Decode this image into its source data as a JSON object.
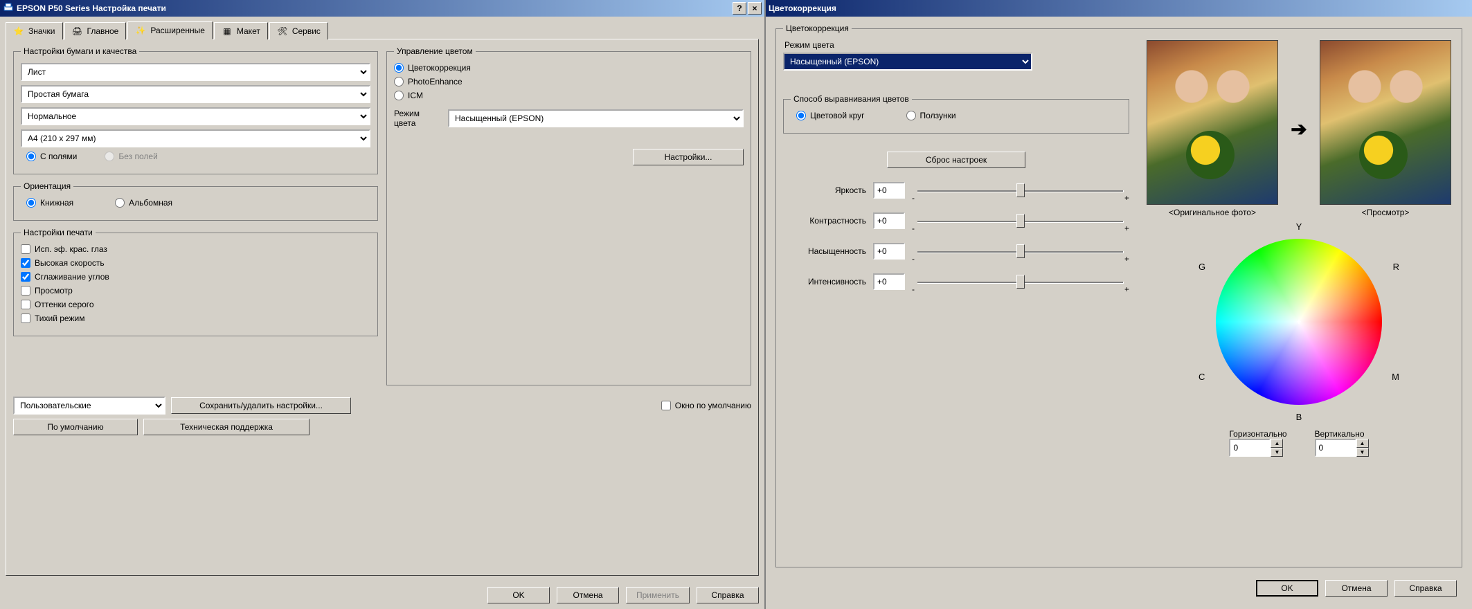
{
  "win1": {
    "title": "EPSON P50 Series Настройка печати",
    "help_btn": "?",
    "close_btn": "×",
    "tabs": [
      {
        "label": "Значки"
      },
      {
        "label": "Главное"
      },
      {
        "label": "Расширенные"
      },
      {
        "label": "Макет"
      },
      {
        "label": "Сервис"
      }
    ],
    "paper_group": "Настройки бумаги и качества",
    "source": "Лист",
    "media": "Простая бумага",
    "quality": "Нормальное",
    "size": "A4 (210 x 297 мм)",
    "margins_on": "С полями",
    "margins_off": "Без полей",
    "orient_group": "Ориентация",
    "orient_portrait": "Книжная",
    "orient_landscape": "Альбомная",
    "print_group": "Настройки печати",
    "opt_redeye": "Исп. эф. крас. глаз",
    "opt_speed": "Высокая скорость",
    "opt_smooth": "Сглаживание углов",
    "opt_preview": "Просмотр",
    "opt_gray": "Оттенки серого",
    "opt_quiet": "Тихий режим",
    "color_group": "Управление цветом",
    "c_corr": "Цветокоррекция",
    "c_photo": "PhotoEnhance",
    "c_icm": "ICM",
    "mode_label": "Режим цвета",
    "mode_value": "Насыщенный (EPSON)",
    "settings_btn": "Настройки...",
    "preset_value": "Пользовательские",
    "save_btn": "Сохранить/удалить настройки...",
    "default_window": "Окно по умолчанию",
    "defaults_btn": "По умолчанию",
    "support_btn": "Техническая поддержка",
    "ok": "OK",
    "cancel": "Отмена",
    "apply": "Применить",
    "help": "Справка"
  },
  "win2": {
    "title": "Цветокоррекция",
    "group": "Цветокоррекция",
    "mode_label": "Режим цвета",
    "mode_value": "Насыщенный (EPSON)",
    "align_group": "Способ выравнивания цветов",
    "align_wheel": "Цветовой круг",
    "align_sliders": "Ползунки",
    "reset_btn": "Сброс настроек",
    "brightness": {
      "label": "Яркость",
      "value": "+0"
    },
    "contrast": {
      "label": "Контрастность",
      "value": "+0"
    },
    "saturation": {
      "label": "Насыщенность",
      "value": "+0"
    },
    "intensity": {
      "label": "Интенсивность",
      "value": "+0"
    },
    "orig_label": "<Оригинальное фото>",
    "preview_label": "<Просмотр>",
    "wheel": {
      "Y": "Y",
      "G": "G",
      "C": "C",
      "B": "B",
      "M": "M",
      "R": "R"
    },
    "horiz": {
      "label": "Горизонтально",
      "value": "0"
    },
    "vert": {
      "label": "Вертикально",
      "value": "0"
    },
    "ok": "OK",
    "cancel": "Отмена",
    "help": "Справка"
  }
}
